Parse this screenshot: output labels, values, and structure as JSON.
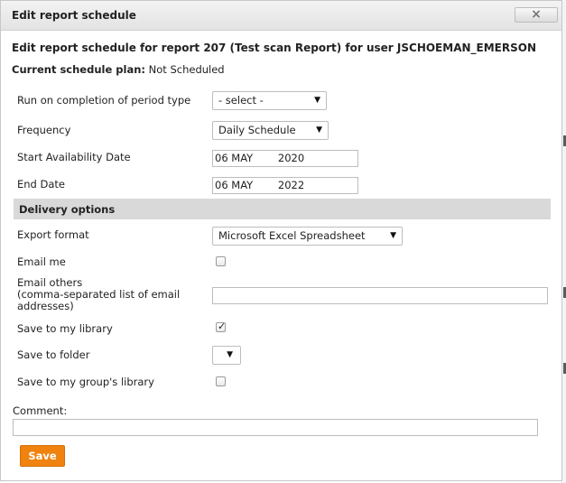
{
  "dialog": {
    "title": "Edit report schedule",
    "close_icon": "×",
    "heading": "Edit report schedule for report 207 (Test scan Report) for user JSCHOEMAN_EMERSON",
    "plan_label": "Current schedule plan:",
    "plan_value": " Not Scheduled"
  },
  "form": {
    "period_type": {
      "label": "Run on completion of period type",
      "value": "- select -"
    },
    "frequency": {
      "label": "Frequency",
      "value": "Daily Schedule"
    },
    "start_date": {
      "label": "Start Availability Date",
      "day_month": "06 MAY",
      "year": "2020"
    },
    "end_date": {
      "label": "End Date",
      "day_month": "06 MAY",
      "year": "2022"
    }
  },
  "delivery": {
    "section_title": "Delivery options",
    "export_format": {
      "label": "Export format",
      "value": "Microsoft Excel Spreadsheet"
    },
    "email_me": {
      "label": "Email me",
      "checked": false
    },
    "email_others": {
      "label_line1": "Email others",
      "label_line2": "(comma-separated list of email",
      "label_line3": "addresses)",
      "value": ""
    },
    "save_library": {
      "label": "Save to my library",
      "checked": true
    },
    "save_folder": {
      "label": "Save to folder",
      "value": ""
    },
    "save_group": {
      "label": "Save to my group's library",
      "checked": false
    }
  },
  "comment": {
    "label": "Comment:",
    "value": ""
  },
  "actions": {
    "save_label": "Save"
  },
  "icons": {
    "dropdown": "chevron-down-icon",
    "check": "check-icon",
    "close": "close-icon"
  },
  "colors": {
    "save_button": "#f0820f",
    "section_bar": "#d9d9d9",
    "titlebar": "#e8e8e8"
  }
}
